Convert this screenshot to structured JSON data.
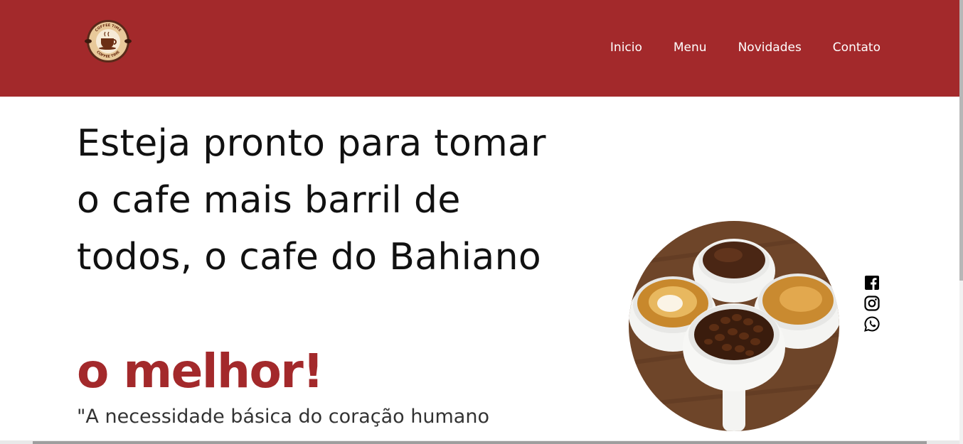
{
  "header": {
    "logo": {
      "icon": "coffee-cup-badge-logo",
      "text": "COFFEE TIME"
    },
    "nav": [
      "Inicio",
      "Menu",
      "Novidades",
      "Contato"
    ]
  },
  "hero": {
    "headline": "Esteja pronto para tomar o cafe mais barril de todos, o cafe do Bahiano",
    "emphasis": "o melhor!",
    "quote": "\"A necessidade básica do coração humano"
  },
  "social": [
    "facebook-icon",
    "instagram-icon",
    "whatsapp-icon"
  ],
  "colors": {
    "brand": "#a3292b",
    "text": "#111111",
    "background": "#ffffff"
  }
}
